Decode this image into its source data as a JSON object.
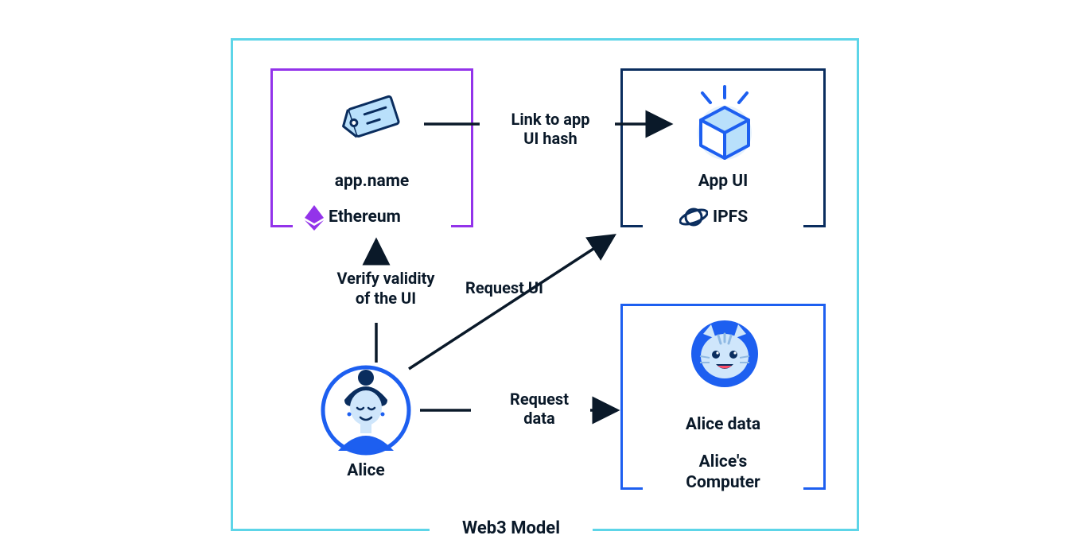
{
  "title": "Web3 Model",
  "boxes": {
    "ethereum": {
      "item_label": "app.name",
      "network_label": "Ethereum"
    },
    "ipfs": {
      "item_label": "App UI",
      "network_label": "IPFS"
    },
    "alice_computer": {
      "item_label": "Alice data",
      "box_label_line1": "Alice's",
      "box_label_line2": "Computer"
    }
  },
  "actors": {
    "alice": {
      "label": "Alice"
    }
  },
  "arrows": {
    "link_to_app": {
      "label_line1": "Link to app",
      "label_line2": "UI hash"
    },
    "verify": {
      "label_line1": "Verify validity",
      "label_line2": "of the UI"
    },
    "request_ui": {
      "label": "Request UI"
    },
    "request_data": {
      "label_line1": "Request",
      "label_line2": "data"
    }
  },
  "colors": {
    "outer_frame": "#5dd5e8",
    "ethereum_box": "#9333ea",
    "ipfs_box": "#0a2d5e",
    "alice_box": "#1d5ff0",
    "text": "#0a1929"
  }
}
